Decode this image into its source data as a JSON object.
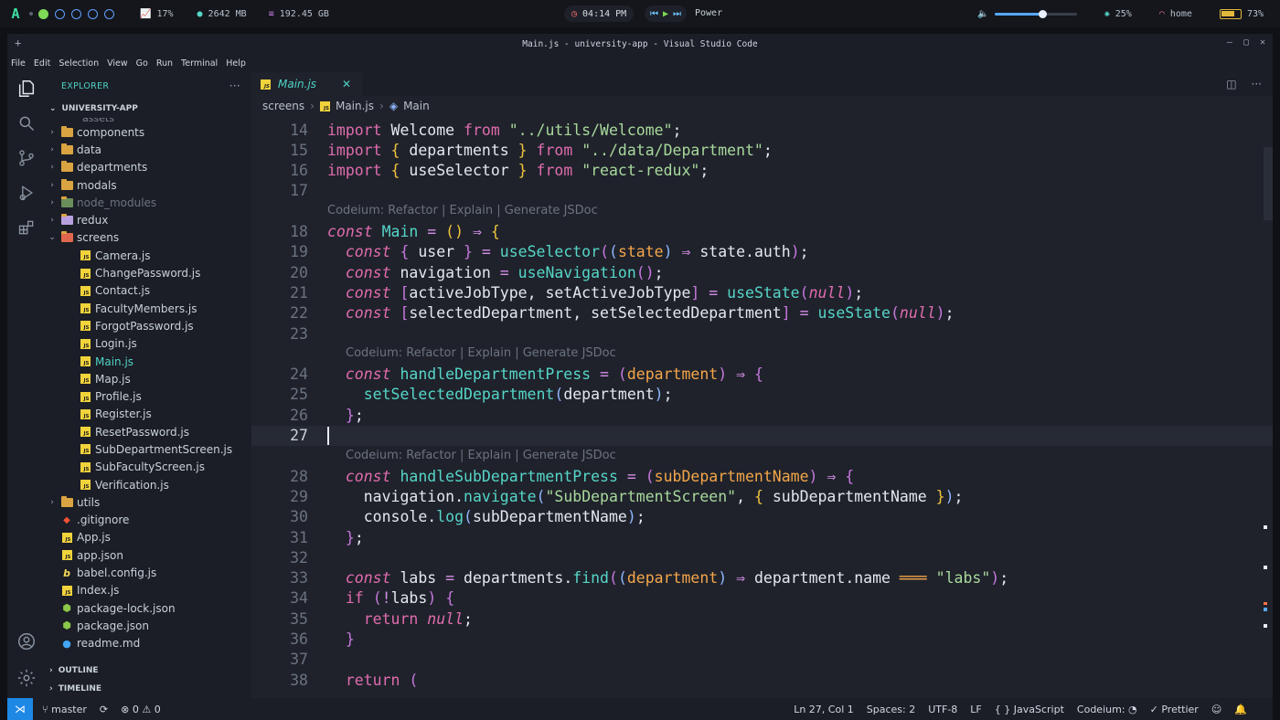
{
  "topbar": {
    "cpu": "17%",
    "ram": "2642 MB",
    "disk": "192.45 GB",
    "time": "04:14 PM",
    "power_label": "Power",
    "brightness": "25%",
    "wifi": "home",
    "battery": "73%",
    "volume_fraction": 0.58,
    "battery_fraction": 0.73
  },
  "window": {
    "title": "Main.js - university-app - Visual Studio Code",
    "menu": [
      "File",
      "Edit",
      "Selection",
      "View",
      "Go",
      "Run",
      "Terminal",
      "Help"
    ]
  },
  "sidebar": {
    "title": "EXPLORER",
    "project": "UNIVERSITY-APP",
    "partial_top": "assets",
    "items": [
      {
        "label": "components",
        "type": "folder",
        "depth": 1
      },
      {
        "label": "data",
        "type": "folder",
        "depth": 1
      },
      {
        "label": "departments",
        "type": "folder",
        "depth": 1
      },
      {
        "label": "modals",
        "type": "folder",
        "depth": 1
      },
      {
        "label": "node_modules",
        "type": "folder-muted",
        "depth": 1
      },
      {
        "label": "redux",
        "type": "folder",
        "depth": 1
      },
      {
        "label": "screens",
        "type": "folder-open",
        "depth": 1
      },
      {
        "label": "Camera.js",
        "type": "js",
        "depth": 2
      },
      {
        "label": "ChangePassword.js",
        "type": "js",
        "depth": 2
      },
      {
        "label": "Contact.js",
        "type": "js",
        "depth": 2
      },
      {
        "label": "FacultyMembers.js",
        "type": "js",
        "depth": 2
      },
      {
        "label": "ForgotPassword.js",
        "type": "js",
        "depth": 2
      },
      {
        "label": "Login.js",
        "type": "js",
        "depth": 2
      },
      {
        "label": "Main.js",
        "type": "js-selected",
        "depth": 2
      },
      {
        "label": "Map.js",
        "type": "js",
        "depth": 2
      },
      {
        "label": "Profile.js",
        "type": "js",
        "depth": 2
      },
      {
        "label": "Register.js",
        "type": "js",
        "depth": 2
      },
      {
        "label": "ResetPassword.js",
        "type": "js",
        "depth": 2
      },
      {
        "label": "SubDepartmentScreen.js",
        "type": "js",
        "depth": 2
      },
      {
        "label": "SubFacultyScreen.js",
        "type": "js",
        "depth": 2
      },
      {
        "label": "Verification.js",
        "type": "js",
        "depth": 2
      },
      {
        "label": "utils",
        "type": "folder",
        "depth": 1
      },
      {
        "label": ".gitignore",
        "type": "git",
        "depth": 1
      },
      {
        "label": "App.js",
        "type": "js",
        "depth": 1
      },
      {
        "label": "app.json",
        "type": "json",
        "depth": 1
      },
      {
        "label": "babel.config.js",
        "type": "babel",
        "depth": 1
      },
      {
        "label": "Index.js",
        "type": "js",
        "depth": 1
      },
      {
        "label": "package-lock.json",
        "type": "npm",
        "depth": 1
      },
      {
        "label": "package.json",
        "type": "npm",
        "depth": 1
      },
      {
        "label": "readme.md",
        "type": "info",
        "depth": 1
      }
    ],
    "outline": "OUTLINE",
    "timeline": "TIMELINE"
  },
  "editor": {
    "tab": "Main.js",
    "breadcrumb": [
      "screens",
      "Main.js",
      "Main"
    ],
    "lens": "Codeium: Refactor | Explain | Generate JSDoc",
    "current_line": 27,
    "lines": [
      {
        "n": "14",
        "t": [
          [
            "k",
            "import "
          ],
          [
            "i",
            "Welcome "
          ],
          [
            "k",
            "from "
          ],
          [
            "s",
            "\"../utils/Welcome\""
          ],
          [
            "pu",
            ";"
          ]
        ]
      },
      {
        "n": "15",
        "t": [
          [
            "k",
            "import "
          ],
          [
            "p",
            "{ "
          ],
          [
            "i",
            "departments "
          ],
          [
            "p",
            "} "
          ],
          [
            "k",
            "from "
          ],
          [
            "s",
            "\"../data/Department\""
          ],
          [
            "pu",
            ";"
          ]
        ]
      },
      {
        "n": "16",
        "t": [
          [
            "k",
            "import "
          ],
          [
            "p",
            "{ "
          ],
          [
            "i",
            "useSelector "
          ],
          [
            "p",
            "} "
          ],
          [
            "k",
            "from "
          ],
          [
            "s",
            "\"react-redux\""
          ],
          [
            "pu",
            ";"
          ]
        ]
      },
      {
        "n": "17",
        "t": []
      },
      {
        "lens": true,
        "indent": 0
      },
      {
        "n": "18",
        "t": [
          [
            "ki",
            "const "
          ],
          [
            "f",
            "Main "
          ],
          [
            "op",
            "= "
          ],
          [
            "p",
            "() "
          ],
          [
            "op",
            "⇒ "
          ],
          [
            "p",
            "{"
          ]
        ]
      },
      {
        "n": "19",
        "t": [
          [
            "pu",
            "  "
          ],
          [
            "ki",
            "const "
          ],
          [
            "pm",
            "{ "
          ],
          [
            "i",
            "user "
          ],
          [
            "pm",
            "} "
          ],
          [
            "op",
            "= "
          ],
          [
            "f",
            "useSelector"
          ],
          [
            "pm",
            "("
          ],
          [
            "b",
            "("
          ],
          [
            "pa",
            "state"
          ],
          [
            "b",
            ") "
          ],
          [
            "op",
            "⇒ "
          ],
          [
            "i",
            "state"
          ],
          [
            "pu",
            "."
          ],
          [
            "i",
            "auth"
          ],
          [
            "pm",
            ")"
          ],
          [
            "pu",
            ";"
          ]
        ]
      },
      {
        "n": "20",
        "t": [
          [
            "pu",
            "  "
          ],
          [
            "ki",
            "const "
          ],
          [
            "i",
            "navigation "
          ],
          [
            "op",
            "= "
          ],
          [
            "f",
            "useNavigation"
          ],
          [
            "pm",
            "()"
          ],
          [
            "pu",
            ";"
          ]
        ]
      },
      {
        "n": "21",
        "t": [
          [
            "pu",
            "  "
          ],
          [
            "ki",
            "const "
          ],
          [
            "pm",
            "["
          ],
          [
            "i",
            "activeJobType"
          ],
          [
            "pu",
            ", "
          ],
          [
            "i",
            "setActiveJobType"
          ],
          [
            "pm",
            "] "
          ],
          [
            "op",
            "= "
          ],
          [
            "f",
            "useState"
          ],
          [
            "pm",
            "("
          ],
          [
            "nu",
            "null"
          ],
          [
            "pm",
            ")"
          ],
          [
            "pu",
            ";"
          ]
        ]
      },
      {
        "n": "22",
        "t": [
          [
            "pu",
            "  "
          ],
          [
            "ki",
            "const "
          ],
          [
            "pm",
            "["
          ],
          [
            "i",
            "selectedDepartment"
          ],
          [
            "pu",
            ", "
          ],
          [
            "i",
            "setSelectedDepartment"
          ],
          [
            "pm",
            "] "
          ],
          [
            "op",
            "= "
          ],
          [
            "f",
            "useState"
          ],
          [
            "pm",
            "("
          ],
          [
            "nu",
            "null"
          ],
          [
            "pm",
            ")"
          ],
          [
            "pu",
            ";"
          ]
        ]
      },
      {
        "n": "23",
        "t": []
      },
      {
        "lens": true,
        "indent": 1
      },
      {
        "n": "24",
        "t": [
          [
            "pu",
            "  "
          ],
          [
            "ki",
            "const "
          ],
          [
            "f",
            "handleDepartmentPress "
          ],
          [
            "op",
            "= "
          ],
          [
            "pm",
            "("
          ],
          [
            "pa",
            "department"
          ],
          [
            "pm",
            ") "
          ],
          [
            "op",
            "⇒ "
          ],
          [
            "pm",
            "{"
          ]
        ]
      },
      {
        "n": "25",
        "t": [
          [
            "pu",
            "    "
          ],
          [
            "f",
            "setSelectedDepartment"
          ],
          [
            "b",
            "("
          ],
          [
            "i",
            "department"
          ],
          [
            "b",
            ")"
          ],
          [
            "pu",
            ";"
          ]
        ]
      },
      {
        "n": "26",
        "t": [
          [
            "pu",
            "  "
          ],
          [
            "pm",
            "}"
          ],
          [
            "pu",
            ";"
          ]
        ]
      },
      {
        "n": "27",
        "t": [],
        "current": true
      },
      {
        "lens": true,
        "indent": 1
      },
      {
        "n": "28",
        "t": [
          [
            "pu",
            "  "
          ],
          [
            "ki",
            "const "
          ],
          [
            "f",
            "handleSubDepartmentPress "
          ],
          [
            "op",
            "= "
          ],
          [
            "pm",
            "("
          ],
          [
            "pa",
            "subDepartmentName"
          ],
          [
            "pm",
            ") "
          ],
          [
            "op",
            "⇒ "
          ],
          [
            "pm",
            "{"
          ]
        ]
      },
      {
        "n": "29",
        "t": [
          [
            "pu",
            "    "
          ],
          [
            "i",
            "navigation"
          ],
          [
            "pu",
            "."
          ],
          [
            "f",
            "navigate"
          ],
          [
            "b",
            "("
          ],
          [
            "s",
            "\"SubDepartmentScreen\""
          ],
          [
            "pu",
            ", "
          ],
          [
            "p",
            "{ "
          ],
          [
            "i",
            "subDepartmentName "
          ],
          [
            "p",
            "}"
          ],
          [
            "b",
            ")"
          ],
          [
            "pu",
            ";"
          ]
        ]
      },
      {
        "n": "30",
        "t": [
          [
            "pu",
            "    "
          ],
          [
            "i",
            "console"
          ],
          [
            "pu",
            "."
          ],
          [
            "f",
            "log"
          ],
          [
            "b",
            "("
          ],
          [
            "i",
            "subDepartmentName"
          ],
          [
            "b",
            ")"
          ],
          [
            "pu",
            ";"
          ]
        ]
      },
      {
        "n": "31",
        "t": [
          [
            "pu",
            "  "
          ],
          [
            "pm",
            "}"
          ],
          [
            "pu",
            ";"
          ]
        ]
      },
      {
        "n": "32",
        "t": []
      },
      {
        "n": "33",
        "t": [
          [
            "pu",
            "  "
          ],
          [
            "ki",
            "const "
          ],
          [
            "i",
            "labs "
          ],
          [
            "op",
            "= "
          ],
          [
            "i",
            "departments"
          ],
          [
            "pu",
            "."
          ],
          [
            "f",
            "find"
          ],
          [
            "pm",
            "("
          ],
          [
            "b",
            "("
          ],
          [
            "pa",
            "department"
          ],
          [
            "b",
            ") "
          ],
          [
            "op",
            "⇒ "
          ],
          [
            "i",
            "department"
          ],
          [
            "pu",
            "."
          ],
          [
            "i",
            "name "
          ],
          [
            "pa",
            "═══ "
          ],
          [
            "s",
            "\"labs\""
          ],
          [
            "pm",
            ")"
          ],
          [
            "pu",
            ";"
          ]
        ]
      },
      {
        "n": "34",
        "t": [
          [
            "pu",
            "  "
          ],
          [
            "k",
            "if "
          ],
          [
            "pm",
            "("
          ],
          [
            "op",
            "!"
          ],
          [
            "i",
            "labs"
          ],
          [
            "pm",
            ") "
          ],
          [
            "pm",
            "{"
          ]
        ]
      },
      {
        "n": "35",
        "t": [
          [
            "pu",
            "    "
          ],
          [
            "k",
            "return "
          ],
          [
            "nu",
            "null"
          ],
          [
            "pu",
            ";"
          ]
        ]
      },
      {
        "n": "36",
        "t": [
          [
            "pu",
            "  "
          ],
          [
            "pm",
            "}"
          ]
        ]
      },
      {
        "n": "37",
        "t": []
      },
      {
        "n": "38",
        "t": [
          [
            "pu",
            "  "
          ],
          [
            "k",
            "return "
          ],
          [
            "pm",
            "("
          ]
        ]
      }
    ]
  },
  "status": {
    "branch": "master",
    "problems": "0",
    "warnings": "0",
    "position": "Ln 27, Col 1",
    "spaces": "Spaces: 2",
    "encoding": "UTF-8",
    "eol": "LF",
    "language": "JavaScript",
    "codeium": "Codeium:",
    "prettier": "Prettier"
  },
  "colors": {
    "accent": "#4fd1c5",
    "remote": "#1e88e5",
    "folder": "#d9a441",
    "js": "#f1d33b"
  }
}
